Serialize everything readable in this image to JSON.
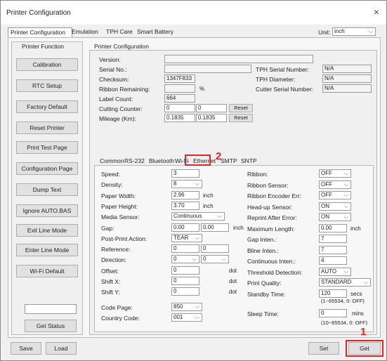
{
  "window": {
    "title": "Printer Configuration",
    "close": "×"
  },
  "tabs": [
    "Printer Configuration",
    "Emulation",
    "TPH Care",
    "Smart Battery"
  ],
  "unit": {
    "label": "Unit:",
    "value": "inch"
  },
  "left": {
    "title": "Printer Function",
    "buttons": [
      "Calibration",
      "RTC Setup",
      "Factory Default",
      "Reset Printer",
      "Print Test Page",
      "Configuration Page",
      "Dump Text",
      "Ignore AUTO.BAS",
      "Exit Line Mode",
      "Enter Line Mode",
      "Wi-Fi Default"
    ],
    "get_status": "Get Status"
  },
  "config": {
    "title": "Printer Configuration",
    "version_label": "Version:",
    "serial_label": "Serial No.:",
    "checksum_label": "Checksum:",
    "checksum_value": "1347F833",
    "ribbon_remaining_label": "Ribbon Remaining:",
    "ribbon_unit": "%",
    "label_count_label": "Label Count:",
    "label_count_value": "664",
    "cutting_counter_label": "Cutting Counter:",
    "cutting_a": "0",
    "cutting_b": "0",
    "reset1": "Reset",
    "mileage_label": "Mileage (Km):",
    "mileage_a": "0.1835",
    "mileage_b": "0.1835",
    "reset2": "Reset",
    "tph_serial_label": "TPH Serial Number:",
    "tph_serial_value": "N/A",
    "tph_diameter_label": "TPH Diameter:",
    "tph_diameter_value": "N/A",
    "cutter_serial_label": "Cutter Serial Number:",
    "cutter_serial_value": "N/A"
  },
  "subtabs": [
    "Common",
    "RS-232",
    "Bluetooth",
    "Wi-Fi",
    "Ethernet",
    "SMTP",
    "SNTP"
  ],
  "common": {
    "left_rows": [
      {
        "label": "Speed:",
        "value": "3",
        "unit": "",
        "kind": "field"
      },
      {
        "label": "Density:",
        "value": "8",
        "unit": "",
        "kind": "select"
      },
      {
        "label": "Paper Width:",
        "value": "2.96",
        "unit": "inch",
        "kind": "field"
      },
      {
        "label": "Paper Height:",
        "value": "3.70",
        "unit": "inch",
        "kind": "field"
      },
      {
        "label": "Media Sensor:",
        "value": "Continuous",
        "unit": "",
        "kind": "select"
      },
      {
        "label": "Gap:",
        "value": "0.00",
        "value2": "0.00",
        "unit": "inch",
        "kind": "double"
      },
      {
        "label": "Post-Print Action:",
        "value": "TEAR",
        "unit": "",
        "kind": "select"
      },
      {
        "label": "Reference:",
        "value": "0",
        "value2": "0",
        "unit": "",
        "kind": "double"
      },
      {
        "label": "Direction:",
        "value": "0",
        "value2": "0",
        "unit": "",
        "kind": "doubleselect"
      },
      {
        "label": "Offset:",
        "value": "0",
        "unit": "dot",
        "kind": "field"
      },
      {
        "label": "Shift X:",
        "value": "0",
        "unit": "dot",
        "kind": "field"
      },
      {
        "label": "Shift Y:",
        "value": "0",
        "unit": "dot",
        "kind": "field"
      },
      {
        "label": "Code Page:",
        "value": "850",
        "unit": "",
        "kind": "select"
      },
      {
        "label": "Country Code:",
        "value": "001",
        "unit": "",
        "kind": "select"
      }
    ],
    "right_rows": [
      {
        "label": "Ribbon:",
        "value": "OFF",
        "kind": "select"
      },
      {
        "label": "Ribbon Sensor:",
        "value": "OFF",
        "kind": "select"
      },
      {
        "label": "Ribbon Encoder Err:",
        "value": "OFF",
        "kind": "select"
      },
      {
        "label": "Head-up Sensor:",
        "value": "ON",
        "kind": "select"
      },
      {
        "label": "Reprint After Error:",
        "value": "ON",
        "kind": "select"
      },
      {
        "label": "Maximum Length:",
        "value": "0.00",
        "unit": "inch",
        "kind": "field"
      },
      {
        "label": "Gap Inten.:",
        "value": "7",
        "kind": "field"
      },
      {
        "label": "Bline Inten.:",
        "value": "7",
        "kind": "field"
      },
      {
        "label": "Continuous Inten.:",
        "value": "4",
        "kind": "field"
      },
      {
        "label": "Threshold Detection:",
        "value": "AUTO",
        "kind": "select"
      },
      {
        "label": "Print Quality:",
        "value": "STANDARD",
        "kind": "select"
      },
      {
        "label": "Standby Time:",
        "value": "120",
        "unit": "secs",
        "kind": "field"
      }
    ],
    "standby_hint": "(1~65534, 0: OFF)",
    "sleep_label": "Sleep Time:",
    "sleep_value": "0",
    "sleep_unit": "mins",
    "sleep_hint": "(10~65534, 0: OFF)"
  },
  "bottom": {
    "save": "Save",
    "load": "Load",
    "set": "Set",
    "get": "Get"
  },
  "callouts": {
    "one": "1",
    "two": "2"
  }
}
